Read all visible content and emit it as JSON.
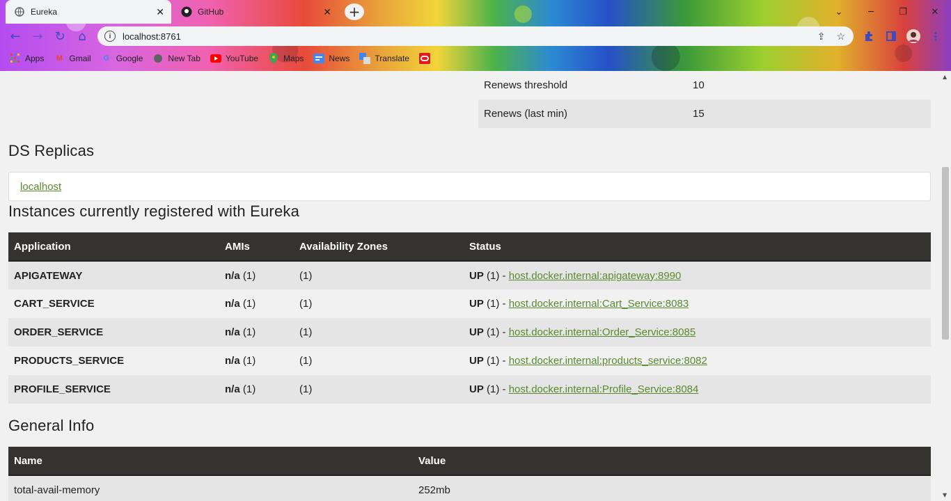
{
  "browser": {
    "tabs": [
      {
        "title": "Eureka",
        "active": true
      },
      {
        "title": "GitHub",
        "active": false
      }
    ],
    "url": "localhost:8761",
    "bookmarks": [
      "Apps",
      "Gmail",
      "Google",
      "New Tab",
      "YouTube",
      "Maps",
      "News",
      "Translate"
    ]
  },
  "stats": [
    {
      "key": "Renews threshold",
      "value": "10"
    },
    {
      "key": "Renews (last min)",
      "value": "15"
    }
  ],
  "ds_replicas": {
    "heading": "DS Replicas",
    "link": "localhost"
  },
  "instances": {
    "heading": "Instances currently registered with Eureka",
    "columns": [
      "Application",
      "AMIs",
      "Availability Zones",
      "Status"
    ],
    "rows": [
      {
        "app": "APIGATEWAY",
        "ami": "n/a",
        "ami_count": "(1)",
        "zones": "(1)",
        "status": "UP",
        "status_count": "(1) -",
        "link": "host.docker.internal:apigateway:8990"
      },
      {
        "app": "CART_SERVICE",
        "ami": "n/a",
        "ami_count": "(1)",
        "zones": "(1)",
        "status": "UP",
        "status_count": "(1) -",
        "link": "host.docker.internal:Cart_Service:8083"
      },
      {
        "app": "ORDER_SERVICE",
        "ami": "n/a",
        "ami_count": "(1)",
        "zones": "(1)",
        "status": "UP",
        "status_count": "(1) -",
        "link": "host.docker.internal:Order_Service:8085"
      },
      {
        "app": "PRODUCTS_SERVICE",
        "ami": "n/a",
        "ami_count": "(1)",
        "zones": "(1)",
        "status": "UP",
        "status_count": "(1) -",
        "link": "host.docker.internal:products_service:8082"
      },
      {
        "app": "PROFILE_SERVICE",
        "ami": "n/a",
        "ami_count": "(1)",
        "zones": "(1)",
        "status": "UP",
        "status_count": "(1) -",
        "link": "host.docker.internal:Profile_Service:8084"
      }
    ]
  },
  "general_info": {
    "heading": "General Info",
    "columns": [
      "Name",
      "Value"
    ],
    "rows": [
      {
        "name": "total-avail-memory",
        "value": "252mb"
      }
    ]
  },
  "colors": {
    "table_header": "#353330",
    "link": "#5a8a2d",
    "alt_row": "#e5e5e5",
    "page_bg": "#f1f1f1"
  }
}
